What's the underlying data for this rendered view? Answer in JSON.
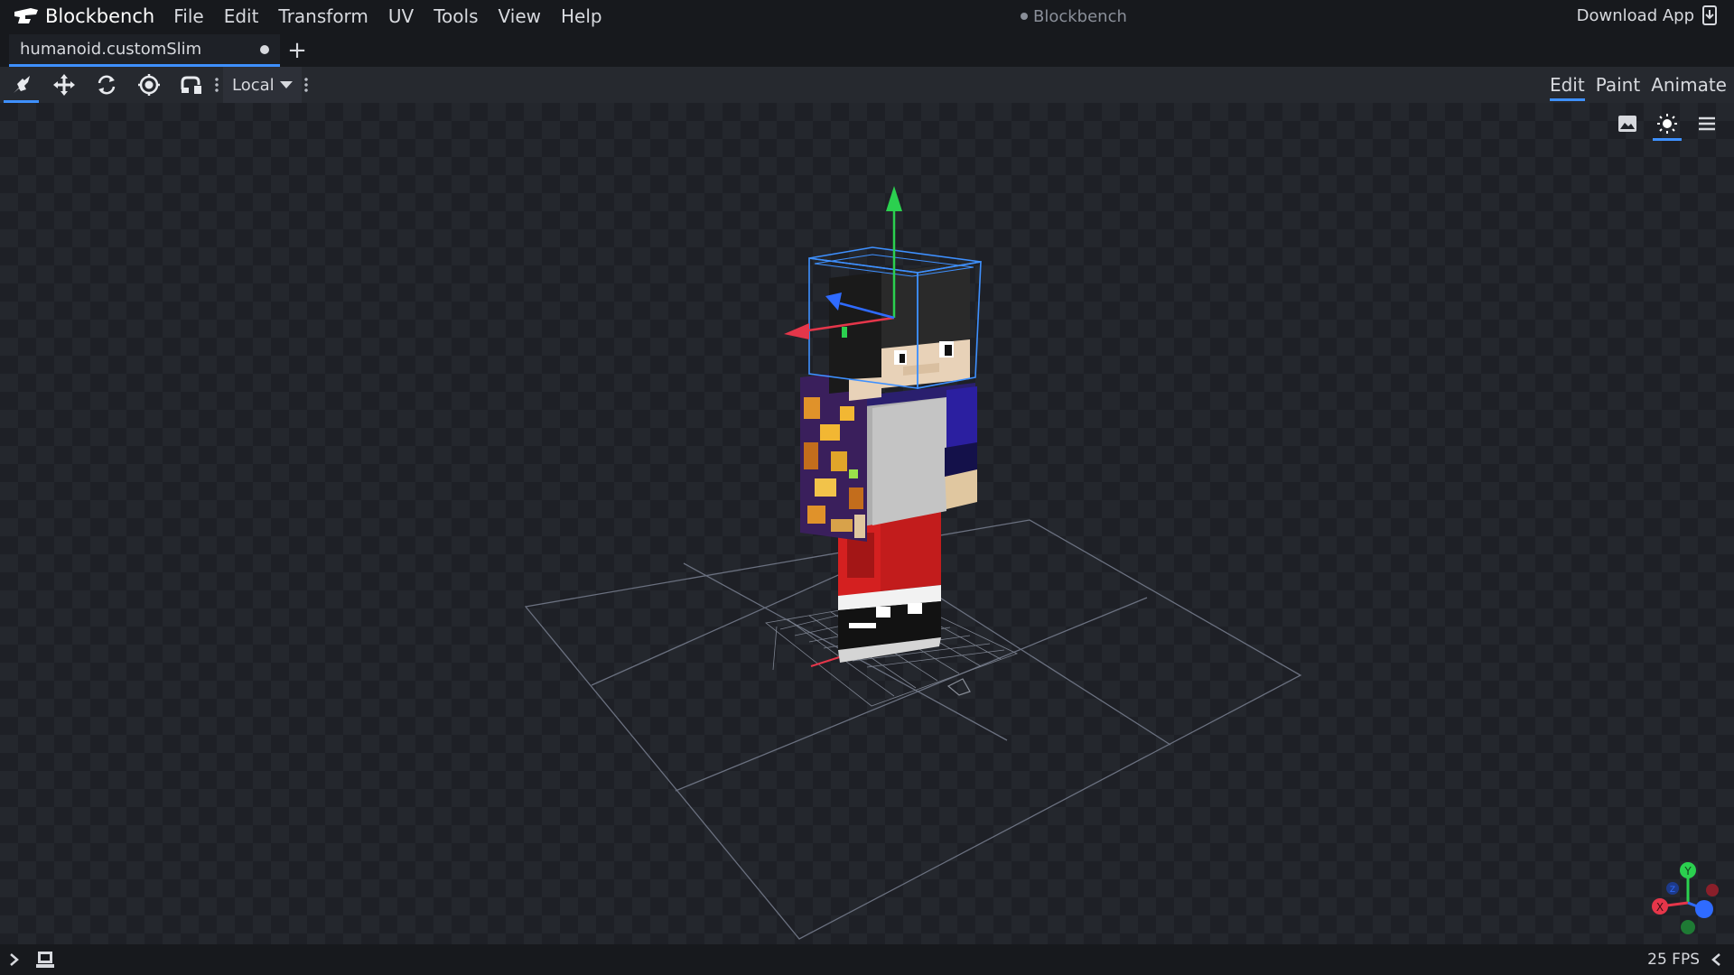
{
  "app": {
    "name": "Blockbench",
    "menu": [
      "File",
      "Edit",
      "Transform",
      "UV",
      "Tools",
      "View",
      "Help"
    ],
    "window_title": "Blockbench",
    "download_label": "Download App"
  },
  "tabs": {
    "file_name": "humanoid.customSlim",
    "new_tab_symbol": "+"
  },
  "toolbar": {
    "tools": [
      "vertex-snap-icon",
      "move-icon",
      "rotate-icon",
      "pivot-icon",
      "resize-icon"
    ],
    "space_value": "Local"
  },
  "modes": {
    "edit": "Edit",
    "paint": "Paint",
    "animate": "Animate",
    "active": "Edit"
  },
  "viewport": {
    "accent": "#3e90ff",
    "axis_colors": {
      "x": "#e5364a",
      "y": "#2bd04f",
      "z": "#2f6bff"
    },
    "gizmo_labels": {
      "x": "X",
      "y": "Y",
      "z": "Z"
    }
  },
  "status": {
    "fps": "25 FPS"
  }
}
